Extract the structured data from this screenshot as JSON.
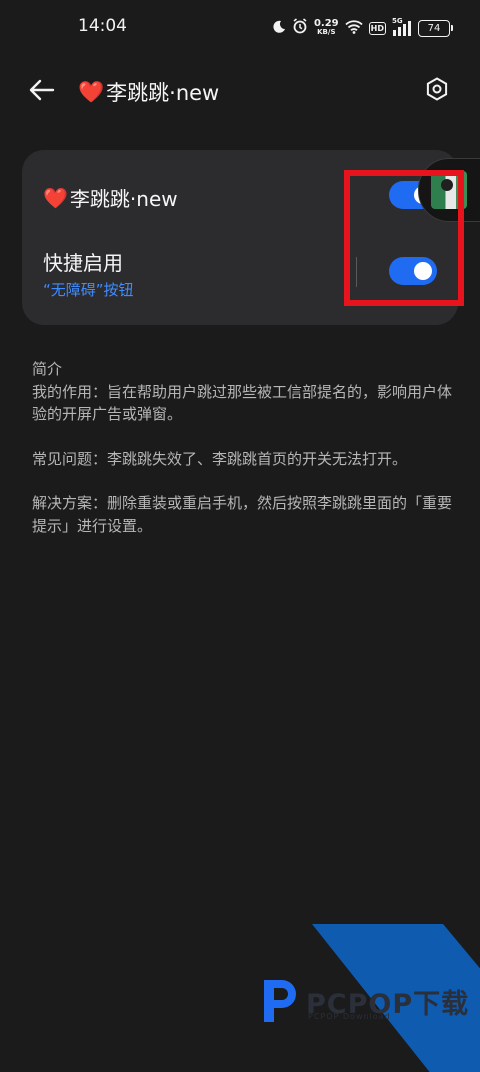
{
  "status_bar": {
    "time": "14:04",
    "net_speed_value": "0.29",
    "net_speed_unit": "KB/S",
    "hd": "HD",
    "signal_label": "5G",
    "battery": "74",
    "icons": [
      "moon-icon",
      "alarm-icon",
      "wifi-icon",
      "signal-icon",
      "battery-icon"
    ]
  },
  "app_bar": {
    "heart": "❤️",
    "title": "李跳跳·new",
    "back_icon": "arrow-left-icon",
    "settings_icon": "settings-icon"
  },
  "card": {
    "row1_heart": "❤️",
    "row1_label": "李跳跳·new",
    "row1_on": true,
    "row2_label": "快捷启用",
    "row2_sub": "“无障碍”按钮",
    "row2_on": true
  },
  "intro": {
    "heading": "简介",
    "p1": "我的作用：旨在帮助用户跳过那些被工信部提名的，影响用户体验的开屏广告或弹窗。",
    "p2": "常见问题：李跳跳失效了、李跳跳首页的开关无法打开。",
    "p3": "解决方案：删除重装或重启手机，然后按照李跳跳里面的「重要提示」进行设置。"
  },
  "watermark": {
    "brand": "PCPOP下载",
    "sub": "PCPOP Download"
  },
  "colors": {
    "background": "#1b1b1c",
    "card": "#2c2c2e",
    "accent": "#1f6cf2",
    "link": "#3f8cff",
    "highlight": "#e8141d",
    "heart": "#e0272b"
  }
}
